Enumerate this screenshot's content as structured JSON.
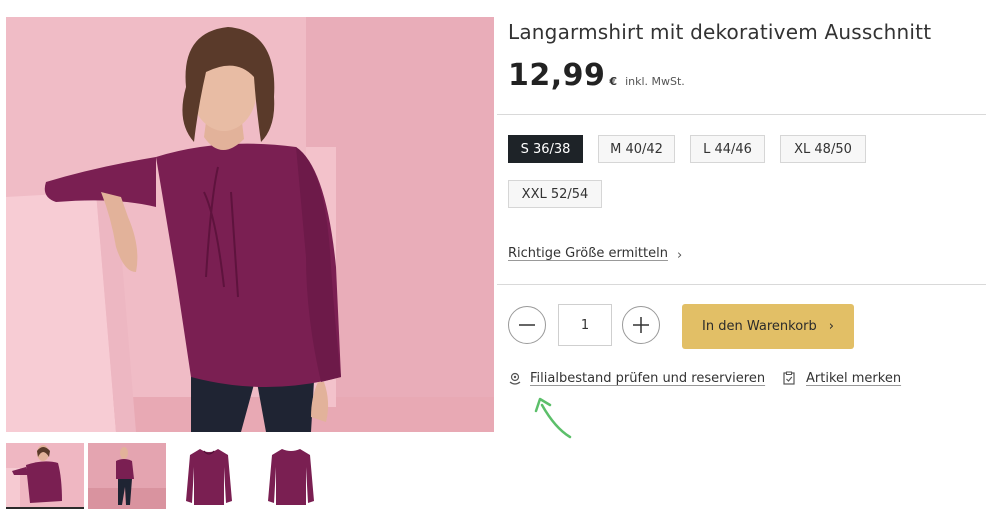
{
  "product": {
    "title": "Langarmshirt mit dekorativem Ausschnitt",
    "price": "12,99",
    "currency": "€",
    "tax_note": "inkl. MwSt."
  },
  "sizes": [
    {
      "label": "S 36/38",
      "selected": true
    },
    {
      "label": "M 40/42",
      "selected": false
    },
    {
      "label": "L 44/46",
      "selected": false
    },
    {
      "label": "XL 48/50",
      "selected": false
    },
    {
      "label": "XXL 52/54",
      "selected": false
    }
  ],
  "size_help": {
    "label": "Richtige Größe ermitteln",
    "chevron": "›"
  },
  "quantity": {
    "value": "1",
    "minus_icon": "minus-icon",
    "plus_icon": "plus-icon"
  },
  "cart": {
    "label": "In den Warenkorb",
    "chevron": "›",
    "color": "#e2bf66"
  },
  "actions": {
    "store_check": "Filialbestand prüfen und reservieren",
    "store_icon": "location-pin-icon",
    "wishlist": "Artikel merken",
    "wishlist_icon": "clipboard-check-icon"
  },
  "colors": {
    "product": "#7a1f52",
    "background_pink": "#efb7c2",
    "selected_size": "#1e2328",
    "annotation_arrow": "#5cbf6a"
  }
}
